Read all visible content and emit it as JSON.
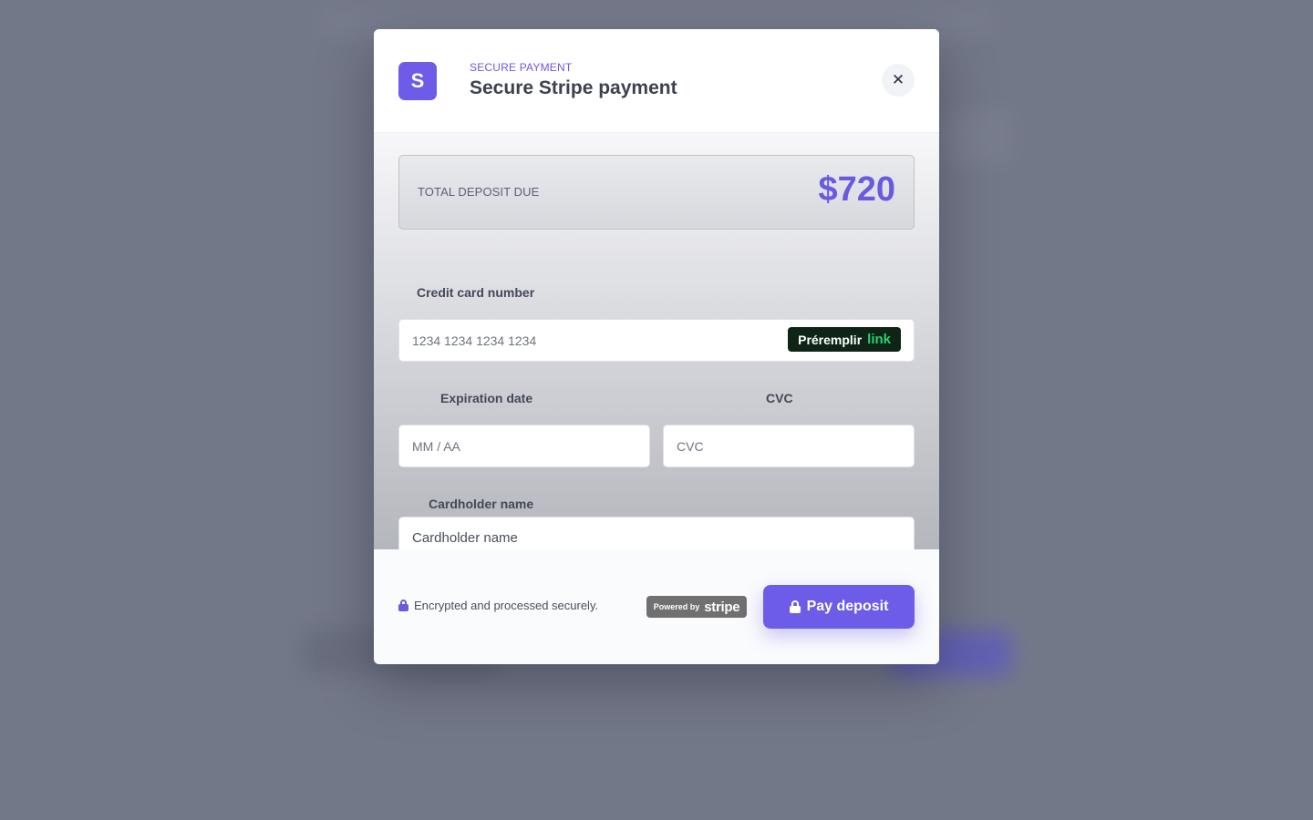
{
  "modal": {
    "brand_letter": "S",
    "eyebrow": "SECURE PAYMENT",
    "title": "Secure Stripe payment",
    "close_icon": "close-icon"
  },
  "total": {
    "label": "TOTAL DEPOSIT DUE",
    "amount": "$720"
  },
  "card": {
    "number_label": "Credit card number",
    "number_placeholder": "1234 1234 1234 1234",
    "link_button_text": "Préremplir",
    "link_word": "link",
    "expiry_label": "Expiration date",
    "expiry_placeholder": "MM / AA",
    "cvc_label": "CVC",
    "cvc_placeholder": "CVC",
    "name_label": "Cardholder name",
    "name_placeholder": "Cardholder name"
  },
  "footer": {
    "secure_note": "Encrypted and processed securely.",
    "powered_by": "Powered by",
    "stripe_word": "stripe",
    "pay_button": "Pay deposit",
    "lock_icon": "lock-icon"
  },
  "colors": {
    "accent": "#6c5ce7",
    "link_green": "#2bd06e",
    "backdrop": "#737889"
  }
}
